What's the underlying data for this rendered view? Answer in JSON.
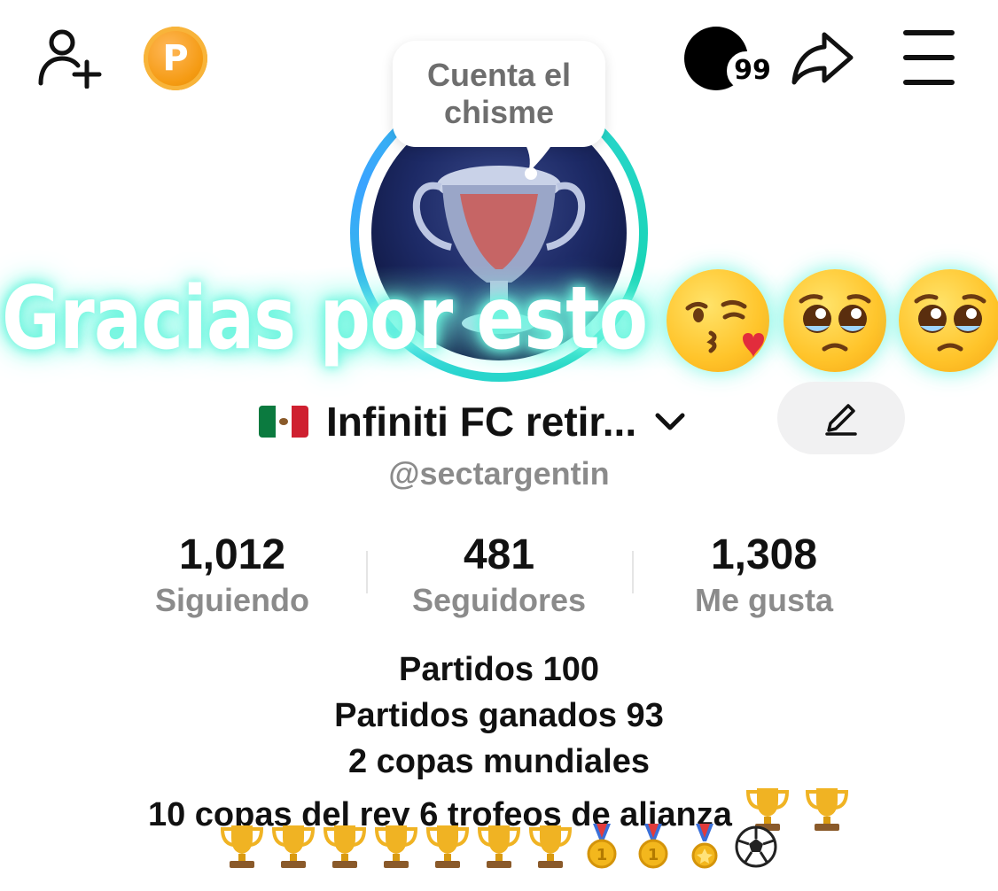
{
  "header": {
    "add_user_icon": "add-user-icon",
    "coin_letter": "P",
    "notifications_badge": "99",
    "share_icon": "share-icon",
    "menu_icon": "hamburger-menu-icon"
  },
  "avatar": {
    "bubble_text": "Cuenta el chisme"
  },
  "overlay": {
    "text": "Gracias por esto",
    "emojis": [
      "kissing-face-with-heart",
      "pleading-face",
      "pleading-face"
    ]
  },
  "profile": {
    "flag": "mexico-flag",
    "display_name": "Infiniti FC retir...",
    "handle": "@sectargentin"
  },
  "stats": [
    {
      "value": "1,012",
      "label": "Siguiendo"
    },
    {
      "value": "481",
      "label": "Seguidores"
    },
    {
      "value": "1,308",
      "label": "Me gusta"
    }
  ],
  "bio": {
    "lines": [
      "Partidos 100",
      "Partidos ganados 93",
      "2 copas mundiales",
      "10 copas del rey 6 trofeos de alianza"
    ],
    "line4_trophies": 2,
    "row_emojis": [
      "trophy",
      "trophy",
      "trophy",
      "trophy",
      "trophy",
      "trophy",
      "trophy",
      "gold-medal",
      "gold-medal",
      "sports-medal",
      "soccer-ball"
    ]
  },
  "colors": {
    "coin": "#f59b13",
    "ring": "#2bd5d0",
    "secondary_text": "#8b8b8b",
    "edit_button_bg": "#f1f1f2"
  }
}
